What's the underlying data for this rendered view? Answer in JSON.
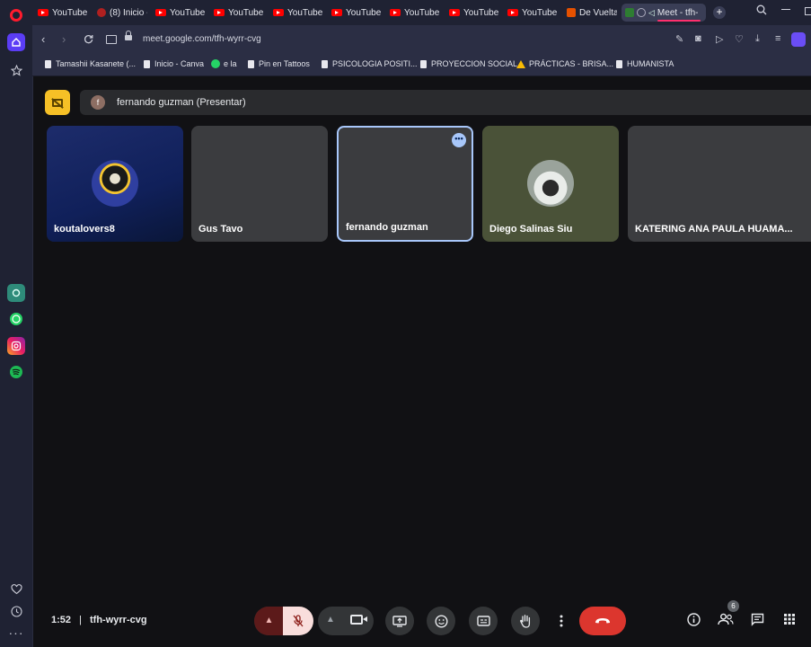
{
  "browser": {
    "tabs": [
      {
        "title": "YouTube"
      },
      {
        "title": "(8) Inicio -"
      },
      {
        "title": "YouTube"
      },
      {
        "title": "YouTube"
      },
      {
        "title": "YouTube"
      },
      {
        "title": "YouTube"
      },
      {
        "title": "YouTube"
      },
      {
        "title": "YouTube"
      },
      {
        "title": "YouTube"
      },
      {
        "title": "De Vuelta"
      }
    ],
    "active_tab": {
      "title": "Meet - tfh-"
    },
    "new_tab": "+",
    "url": "meet.google.com/tfh-wyrr-cvg",
    "bookmarks": [
      {
        "label": "Tamashii Kasanete (..."
      },
      {
        "label": "Inicio - Canva"
      },
      {
        "label": "e la"
      },
      {
        "label": "Pin en Tattoos"
      },
      {
        "label": "PSICOLOGIA POSITI..."
      },
      {
        "label": "PROYECCION SOCIAL"
      },
      {
        "label": "PRÁCTICAS - BRISA..."
      },
      {
        "label": "HUMANISTA"
      }
    ]
  },
  "meet": {
    "presenter": {
      "initial": "f",
      "label": "fernando guzman (Presentar)"
    },
    "participants": [
      {
        "name": "koutalovers8"
      },
      {
        "name": "Gus Tavo"
      },
      {
        "name": "fernando guzman"
      },
      {
        "name": "Diego Salinas Siu"
      },
      {
        "name": "KATERING ANA PAULA HUAMA..."
      }
    ],
    "time": "1:52",
    "separator": "|",
    "meeting_code": "tfh-wyrr-cvg",
    "people_count": "6",
    "mic_state": "muted",
    "end_call_color": "#dc362e",
    "accent_color": "#a8c7fa"
  }
}
